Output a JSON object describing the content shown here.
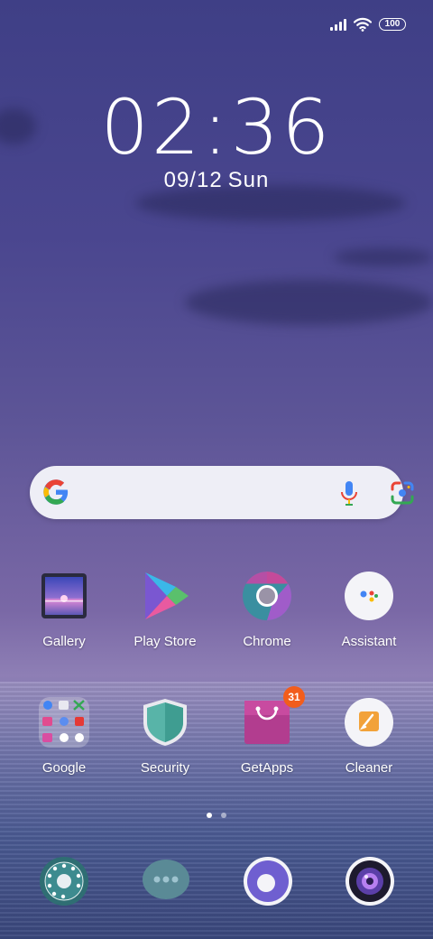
{
  "status_bar": {
    "battery": "100",
    "signal_icon": "signal-icon",
    "wifi_icon": "wifi-icon"
  },
  "clock": {
    "time": "02:36",
    "date": "09/12",
    "day": "Sun"
  },
  "search": {
    "icon": "google-logo",
    "mic_icon": "mic-icon",
    "lens_icon": "lens-icon"
  },
  "apps": [
    {
      "label": "Gallery",
      "icon": "gallery-icon"
    },
    {
      "label": "Play Store",
      "icon": "play-store-icon"
    },
    {
      "label": "Chrome",
      "icon": "chrome-icon"
    },
    {
      "label": "Assistant",
      "icon": "assistant-icon"
    },
    {
      "label": "Google",
      "icon": "google-folder-icon"
    },
    {
      "label": "Security",
      "icon": "security-icon"
    },
    {
      "label": "GetApps",
      "icon": "getapps-icon",
      "badge": "31"
    },
    {
      "label": "Cleaner",
      "icon": "cleaner-icon"
    }
  ],
  "page_indicator": {
    "pages": 2,
    "current": 1
  },
  "dock": [
    {
      "icon": "phone-dialer-icon"
    },
    {
      "icon": "messages-icon"
    },
    {
      "icon": "browser-icon"
    },
    {
      "icon": "camera-icon"
    }
  ]
}
